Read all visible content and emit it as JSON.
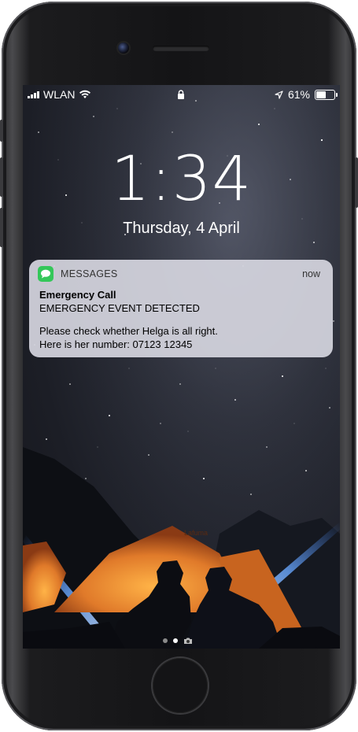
{
  "status_bar": {
    "carrier": "WLAN",
    "battery": "61%",
    "battery_level": 0.61
  },
  "lock_screen": {
    "time": "1:34",
    "date": "Thursday, 4 April"
  },
  "notification": {
    "app_name": "MESSAGES",
    "time": "now",
    "title": "Emergency Call",
    "line1": "EMERGENCY EVENT DETECTED",
    "line2": "Please check whether Helga is all right.",
    "line3": "Here is her number: 07123 12345",
    "icon": "messages-icon",
    "accent": "#34c759"
  },
  "pager": {
    "pages": 2,
    "active_page": 2,
    "camera_icon": "camera-icon"
  },
  "colors": {
    "frame": "#1c1c1e",
    "screen_bg": "#2e313c",
    "tent": "#d9722a"
  }
}
